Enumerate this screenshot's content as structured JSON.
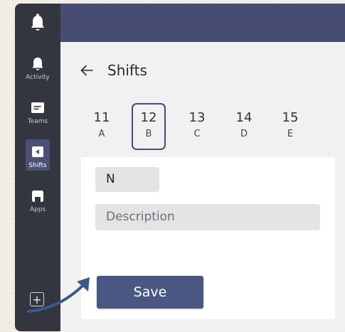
{
  "rail": {
    "items": [
      {
        "label": "Activity",
        "icon": "activity-icon"
      },
      {
        "label": "Teams",
        "icon": "teams-icon"
      },
      {
        "label": "Shifts",
        "icon": "shifts-icon"
      },
      {
        "label": "Apps",
        "icon": "apps-icon"
      }
    ],
    "add_symbol": "+"
  },
  "header": {
    "title": "Shifts"
  },
  "days": [
    {
      "num": "11",
      "letter": "A"
    },
    {
      "num": "12",
      "letter": "B"
    },
    {
      "num": "13",
      "letter": "C"
    },
    {
      "num": "14",
      "letter": "D"
    },
    {
      "num": "15",
      "letter": "E"
    }
  ],
  "selected_day": "12",
  "form": {
    "shift_code": "N",
    "description_placeholder": "Description",
    "save_label": "Save"
  },
  "colors": {
    "rail": "#33363f",
    "topbar": "#474c72",
    "accent": "#4a5783",
    "selected_border": "#3d4f73",
    "arrow": "#3a5a8c"
  }
}
